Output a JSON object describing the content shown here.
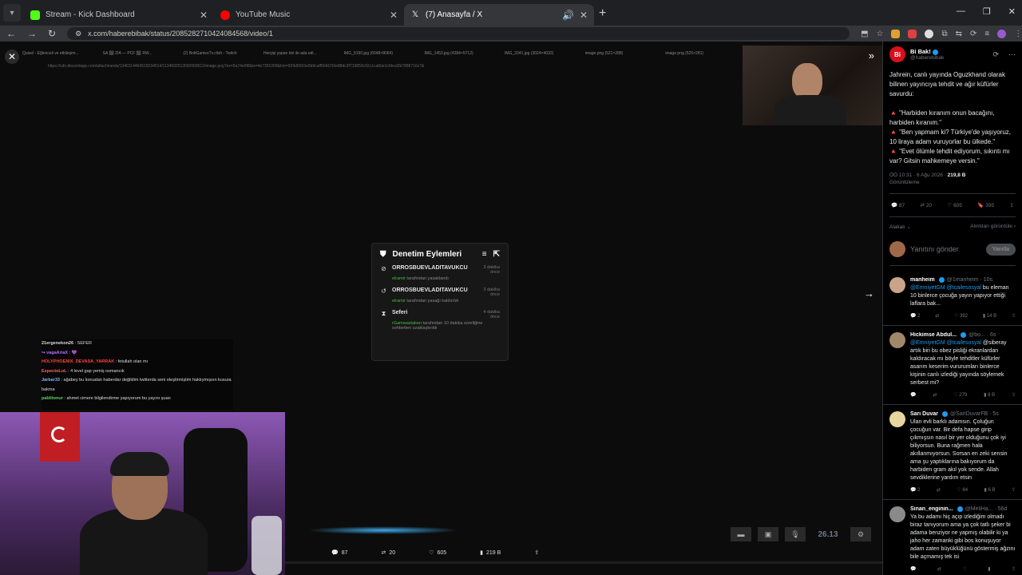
{
  "tabs": [
    {
      "title": "Stream - Kick Dashboard",
      "color": "#53fc18"
    },
    {
      "title": "YouTube Music",
      "color": "#ff0000"
    },
    {
      "title": "(7) Anasayfa / X",
      "color": "#ffffff"
    }
  ],
  "address": {
    "url": "x.com/haberebibak/status/2085282710424084568/video/1"
  },
  "inner_tabs": [
    "Quizel - Eğlenceli ve etkileşim...",
    "SA ⬛ ZIA — PCF ⬛ RW...",
    "(2) BoltGamesTv.clish - Twitch",
    "Herşişi yapan biri ile ada edi...",
    "IMG_9190.jpg (6048×8064)",
    "IMG_1453.jpg (4284×5712)",
    "IMG_3341.jpg (3024×4032)",
    "image.png (521×288)",
    "image.png (525×281)"
  ],
  "inner_url": "https://cdn.discordapp.com/attachments/1340114464519234514/1134692513582658613/image.png?ex=5a74e6f8&is=4e7391009&hm=929d0093e5b8caff59d1f16e88dc3f719859c92c1ca8de1c6bcd2b7886716c7&",
  "panel": {
    "title": "Denetim Eylemleri",
    "rows": [
      {
        "icon": "⊘",
        "user": "ORROSBUEVLADITAVUKCU",
        "time": "3 dakika önce",
        "actor": "elramir",
        "action": "tarafından yasaklandı"
      },
      {
        "icon": "↺",
        "user": "ORROSBUEVLADITAVUKCU",
        "time": "3 dakika önce",
        "actor": "elramir",
        "action": "tarafından yasağı kaldırıldı"
      },
      {
        "icon": "⧗",
        "user": "Seferi",
        "time": "4 dakika önce",
        "actor": "rGamwastaken",
        "action": "tarafından 10 dakika süreliğine sohbetten uzaklaştırıldı"
      }
    ]
  },
  "chat": [
    {
      "user": "21ergenekon26",
      "color": "#dddddd",
      "msg": "SEFER"
    },
    {
      "user": "↪ vagaAriaX",
      "color": "#b56bff",
      "msg": "💜"
    },
    {
      "user": "HOLYPHOENIX_DEVASA_YARRAK",
      "color": "#ff4040",
      "msg": "fetullah olan mı"
    },
    {
      "user": "EspectoLoL",
      "color": "#ff6060",
      "msg": "4 level gap yemiş osmancık"
    },
    {
      "user": "Jarbar33",
      "color": "#8ab4ff",
      "msg": "ağabey bu konudan haberdar değildim twitterda seni eleştirmiştim haklıymışsın kusura bakma"
    },
    {
      "user": "pablitonur",
      "color": "#60d060",
      "msg": "ahmet cimere bilgilendirme yapıyorum bu yayını şuan"
    }
  ],
  "actions": {
    "replies": "87",
    "reposts": "20",
    "likes": "605",
    "views": "219 B"
  },
  "hud": {
    "number": "26.13"
  },
  "post": {
    "name": "Bi Bak!",
    "handle": "@haberebibak",
    "avatar_color": "#d6111b",
    "avatar_text": "Bi",
    "intro": "Jahrein, canlı yayında Oguzkhand olarak bilinen yayıncıya tehdit ve ağır küfürler savurdu:",
    "quotes": [
      "🔺 \"Harbiden kıranım onun bacağını, harbiden kıranım.\"",
      "🔺 \"Ben yapmam ki? Türkiye'de yaşıyoruz, 10 liraya adam vuruyorlar bu ülkede.\"",
      "🔺 \"Evet ölümle tehdit ediyorum, sıkıntı mı var? Gitsin mahkemeye versin.\""
    ],
    "time": "ÖÖ 10:31 · 6 Ağu 2026 ·",
    "views": "219,8 B",
    "views_label": "Görüntüleme",
    "stats": {
      "replies": "87",
      "reposts": "20",
      "likes": "605",
      "bookmarks": "395"
    },
    "sort_left": "Alakalı",
    "sort_right": "Alıntıları görüntüle",
    "reply_placeholder": "Yanıtını gönder",
    "reply_button": "Yanıtla"
  },
  "replies": [
    {
      "name": "manheim",
      "handle": "@1manheim · 10s",
      "avatar": "#c9a48a",
      "mention": "@EmniyetGM @tcailesosyal",
      "text": "bu eleman 10 binlerce çocuğa yayın yapıyor ettiği laflara bak...",
      "stats": {
        "r": "2",
        "rt": "",
        "l": "392",
        "v": "14 B"
      }
    },
    {
      "name": "Hickimse Abdul...",
      "handle": "@bo... · 6s",
      "avatar": "#a08868",
      "mention": "@EmniyetGM @tcailesosyal",
      "text": "@siberay artık biri bu obez pisliği ekranlardan kaldıracak mı böyle tehditler küfürler asarım keserim vururumları binlerce kişinin canlı izlediği yayında söylemek serbest mi?",
      "stats": {
        "r": "",
        "rt": "",
        "l": "279",
        "v": "8 B"
      }
    },
    {
      "name": "Sarı Duvar",
      "handle": "@SariDuvarFB · 5s",
      "avatar": "#e8d6a0",
      "mention": "",
      "text": "Ulan evli barklı adamsın. Çoluğun çocuğun var. Bir defa hapse girip çıkmışsın nasıl bir yer olduğunu çok iyi biliyorsun. Buna rağmen hala akıllanmıyorsun. Sorsan en zeki sensin ama şu yaptıklarına bakıyorum da harbiden gram akıl yok sende. Allah sevdiklerine yardım etsin",
      "stats": {
        "r": "2",
        "rt": "",
        "l": "84",
        "v": "6 B"
      }
    },
    {
      "name": "Sinan_enginin...",
      "handle": "@MeliHa... · 56d",
      "avatar": "#8a8a8a",
      "mention": "",
      "text": "Ya bu adamı hiç açıp izlediğim olmadı biraz tanıyorum ama ya çok tatlı şeker bi adama benziyor ne yapmış olabilir ki ya jaho her zamanki gibi bos konuşuyor adam zaten büyüklüğünü göstermiş ağzını bile açmamış tek isi",
      "stats": {
        "r": "",
        "rt": "",
        "l": "",
        "v": ""
      }
    }
  ]
}
